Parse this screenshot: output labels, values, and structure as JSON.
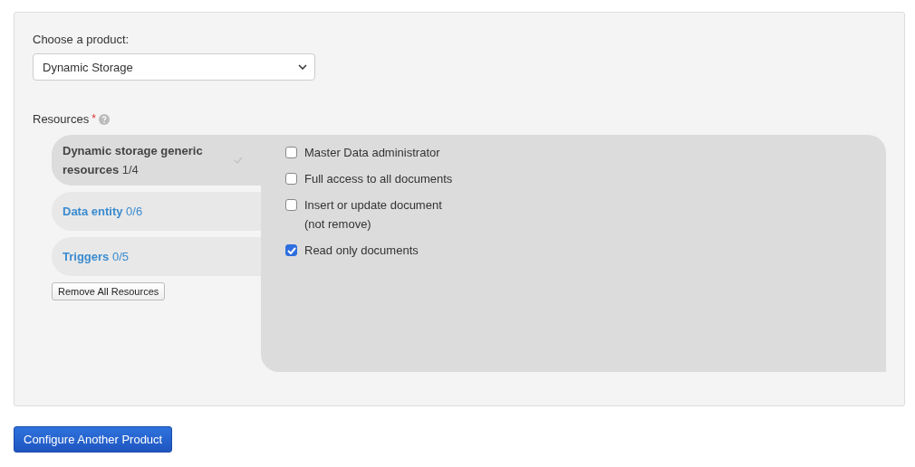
{
  "product": {
    "label": "Choose a product:",
    "value": "Dynamic Storage"
  },
  "resources": {
    "label": "Resources",
    "required_mark": "*",
    "categories": [
      {
        "name": "Dynamic storage generic resources",
        "count": "1/4",
        "selected": true,
        "done": true
      },
      {
        "name": "Data entity",
        "count": "0/6",
        "selected": false,
        "done": false
      },
      {
        "name": "Triggers",
        "count": "0/5",
        "selected": false,
        "done": false
      }
    ],
    "remove_button": "Remove All Resources",
    "options": [
      {
        "label": "Master Data administrator",
        "checked": false
      },
      {
        "label": "Full access to all documents",
        "checked": false
      },
      {
        "label": "Insert or update document (not remove)",
        "checked": false
      },
      {
        "label": "Read only documents",
        "checked": true
      }
    ]
  },
  "configure_button": "Configure Another Product"
}
